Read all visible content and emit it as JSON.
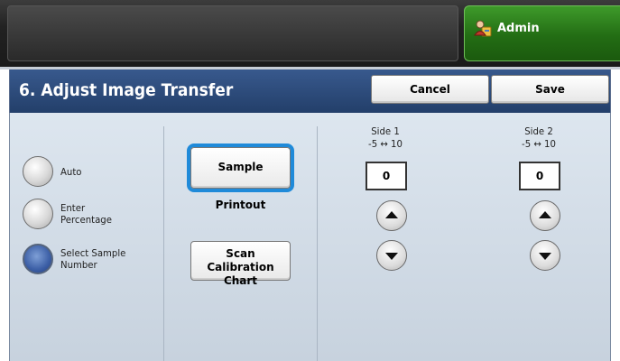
{
  "header": {
    "admin_label": "Admin"
  },
  "titlebar": {
    "title": "6. Adjust Image Transfer",
    "cancel_label": "Cancel",
    "save_label": "Save"
  },
  "options": {
    "items": [
      {
        "label": "Auto",
        "selected": false
      },
      {
        "label": "Enter Percentage",
        "selected": false
      },
      {
        "label": "Select Sample Number",
        "selected": true
      }
    ]
  },
  "buttons": {
    "sample_printout": "Sample Printout",
    "scan_calibration_line1": "Scan Calibration",
    "scan_calibration_line2": "Chart"
  },
  "sides": {
    "side1": {
      "title": "Side 1",
      "range": "-5 ↔ 10",
      "value": "0"
    },
    "side2": {
      "title": "Side 2",
      "range": "-5 ↔ 10",
      "value": "0"
    }
  },
  "icons": {
    "admin": "admin-user-icon",
    "up": "up-arrow-icon",
    "down": "down-arrow-icon"
  },
  "colors": {
    "admin_green": "#236d14",
    "title_blue": "#2b4a7a",
    "focus_blue": "#1f8ad9"
  }
}
